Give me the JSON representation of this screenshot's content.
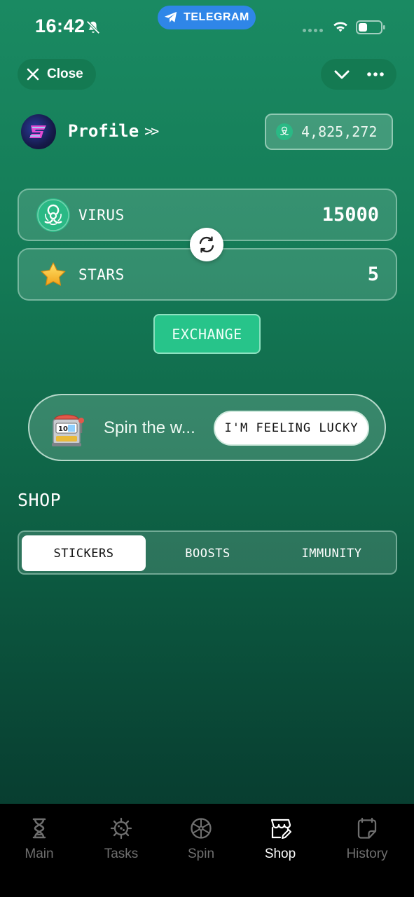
{
  "status_bar": {
    "time": "16:42",
    "telegram_label": "TELEGRAM"
  },
  "header": {
    "close_label": "Close"
  },
  "profile": {
    "label": "Profile",
    "chevron": ">>",
    "balance": "4,825,272"
  },
  "exchange": {
    "from": {
      "label": "VIRUS",
      "value": "15000",
      "icon": "biohazard-icon"
    },
    "to": {
      "label": "STARS",
      "value": "5",
      "icon": "star-icon"
    },
    "button_label": "EXCHANGE"
  },
  "spin_banner": {
    "text": "Spin the w...",
    "button_label": "I'M FEELING LUCKY"
  },
  "shop": {
    "title": "SHOP",
    "tabs": [
      {
        "label": "STICKERS",
        "active": true
      },
      {
        "label": "BOOSTS",
        "active": false
      },
      {
        "label": "IMMUNITY",
        "active": false
      }
    ]
  },
  "bottom_nav": {
    "items": [
      {
        "label": "Main",
        "icon": "hourglass-icon",
        "active": false
      },
      {
        "label": "Tasks",
        "icon": "virus-icon",
        "active": false
      },
      {
        "label": "Spin",
        "icon": "wheel-icon",
        "active": false
      },
      {
        "label": "Shop",
        "icon": "store-icon",
        "active": true
      },
      {
        "label": "History",
        "icon": "note-icon",
        "active": false
      }
    ]
  },
  "colors": {
    "accent_green": "#27c48a",
    "background_top": "#1a8a62",
    "background_bottom": "#073a2d",
    "telegram_blue": "#2f86e8"
  }
}
